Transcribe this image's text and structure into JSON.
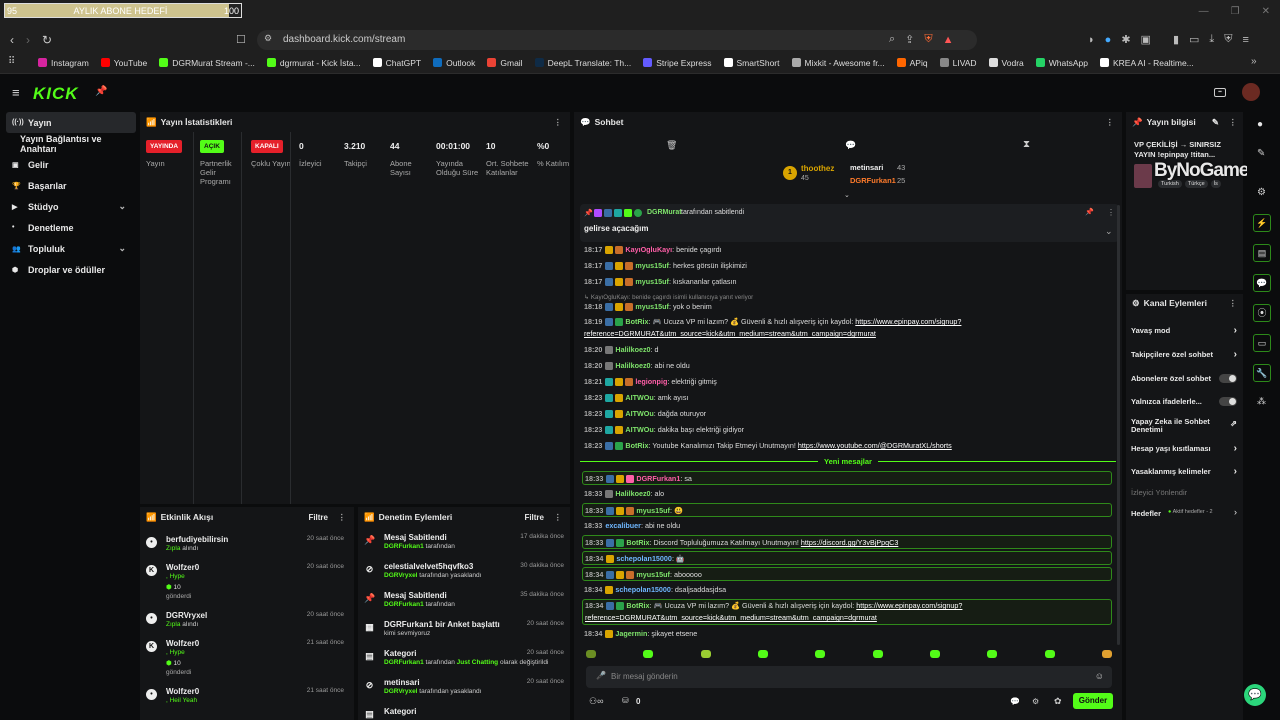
{
  "goal": {
    "left": "95",
    "label": "AYLIK ABONE HEDEFİ",
    "right": "100",
    "progress": 0.95
  },
  "browser": {
    "url": "dashboard.kick.com/stream"
  },
  "bookmarks": [
    {
      "label": "Instagram",
      "color": "#d6249f"
    },
    {
      "label": "YouTube",
      "color": "#ff0000"
    },
    {
      "label": "DGRMurat Stream -...",
      "color": "#53fc18"
    },
    {
      "label": "dgrmurat - Kick İsta...",
      "color": "#53fc18"
    },
    {
      "label": "ChatGPT",
      "color": "#ffffff"
    },
    {
      "label": "Outlook",
      "color": "#0f6cbd"
    },
    {
      "label": "Gmail",
      "color": "#ea4335"
    },
    {
      "label": "DeepL Translate: Th...",
      "color": "#0f2b46"
    },
    {
      "label": "Stripe Express",
      "color": "#635bff"
    },
    {
      "label": "SmartShort",
      "color": "#ffffff"
    },
    {
      "label": "Mixkit - Awesome fr...",
      "color": "#aaaaaa"
    },
    {
      "label": "APiq",
      "color": "#ff6600"
    },
    {
      "label": "LIVAD",
      "color": "#888888"
    },
    {
      "label": "Vodra",
      "color": "#dddddd"
    },
    {
      "label": "WhatsApp",
      "color": "#25d366"
    },
    {
      "label": "KREA AI - Realtime...",
      "color": "#ffffff"
    }
  ],
  "nav": [
    {
      "label": "Yayın",
      "selected": true
    },
    {
      "label": "Yayın Bağlantısı ve Anahtarı"
    },
    {
      "label": "Gelir"
    },
    {
      "label": "Başarılar"
    },
    {
      "label": "Stüdyo",
      "chev": true
    },
    {
      "label": "Denetleme"
    },
    {
      "label": "Topluluk",
      "chev": true
    },
    {
      "label": "Droplar ve ödüller"
    }
  ],
  "stats": {
    "title": "Yayın İstatistikleri",
    "badges": [
      {
        "badge": "YAYINDA",
        "color": "#e5202a",
        "label": "Yayın"
      },
      {
        "badge": "AÇIK",
        "color": "#53fc18",
        "label": "Partnerlik Gelir Programı"
      },
      {
        "badge": "KAPALI",
        "color": "#e5202a",
        "label": "Çoklu Yayın"
      }
    ],
    "values": [
      {
        "value": "0",
        "label": "İzleyici"
      },
      {
        "value": "3.210",
        "label": "Takipçi"
      },
      {
        "value": "44",
        "label": "Abone Sayısı"
      },
      {
        "value": "00:01:00",
        "label": "Yayında Olduğu Süre"
      },
      {
        "value": "10",
        "label": "Ort. Sohbete Katılanlar"
      },
      {
        "value": "%0",
        "label": "% Katılım"
      }
    ]
  },
  "activity": {
    "title": "Etkinlik Akışı",
    "filter": "Filtre",
    "items": [
      {
        "name": "berfudiyebilirsin",
        "sub": "Zıpla",
        "sub_rest": " alındı",
        "time": "20 saat önce"
      },
      {
        "name": "Wolfzer0",
        "sub": ", Hype",
        "count": "10",
        "sub2": "gönderdi",
        "time": "20 saat önce"
      },
      {
        "name": "DGRVryxel",
        "sub": "Zıpla",
        "sub_rest": " alındı",
        "time": "20 saat önce"
      },
      {
        "name": "Wolfzer0",
        "sub": ", Hype",
        "count": "10",
        "sub2": "gönderdi",
        "time": "21 saat önce"
      },
      {
        "name": "Wolfzer0",
        "sub": ", Heil Yeah",
        "time": "21 saat önce"
      }
    ]
  },
  "moderation": {
    "title": "Denetim Eylemleri",
    "filter": "Filtre",
    "items": [
      {
        "title": "Mesaj Sabitlendi",
        "by": "DGRFurkan1",
        "rest": " tarafından",
        "time": "17 dakika önce"
      },
      {
        "title": "celestialvelvet5hqvfko3",
        "by": "DGRVryxel",
        "rest": " tarafından yasaklandı",
        "time": "30 dakika önce"
      },
      {
        "title": "Mesaj Sabitlendi",
        "by": "DGRFurkan1",
        "rest": " tarafından",
        "time": "35 dakika önce"
      },
      {
        "title": "DGRFurkan1 bir Anket başlattı",
        "by": "",
        "rest": "kimi sevmiyoruz",
        "time": "20 saat önce"
      },
      {
        "title": "Kategori",
        "by": "DGRFurkan1",
        "rest": " tarafından Just Chatting olarak değiştirildi",
        "time": "20 saat önce"
      },
      {
        "title": "metinsari",
        "by": "DGRVryxel",
        "rest": " tarafından yasaklandı",
        "time": "20 saat önce"
      },
      {
        "title": "Kategori",
        "by": "",
        "rest": "",
        "time": ""
      }
    ]
  },
  "chat": {
    "title": "Sohbet",
    "top": [
      {
        "name": "thoothez",
        "count": "45",
        "rank": "1"
      },
      {
        "name": "metinsari",
        "count": "43"
      },
      {
        "name": "DGRFurkan1",
        "count": "25"
      }
    ],
    "pinned": {
      "user": "DGRMurat",
      "rest": " tarafından sabitlendi",
      "text": "gelirse açacağım"
    },
    "messages": [
      {
        "t": "18:17",
        "u": "KayıOgluKayı",
        "uc": "#ff5fa8",
        "m": ": benide çagırdı"
      },
      {
        "t": "18:17",
        "u": "myus15uf",
        "uc": "#7ee36b",
        "m": ": herkes görsün ilişkimizi"
      },
      {
        "t": "18:17",
        "u": "myus15uf",
        "uc": "#7ee36b",
        "m": ": kıskananlar çatlasın"
      },
      {
        "t": "",
        "reply": "↳ KayıOgluKayı: benide çagırdı isimli kullanıcıya yanıt veriyor"
      },
      {
        "t": "18:18",
        "u": "myus15uf",
        "uc": "#7ee36b",
        "m": ": yok o benim"
      },
      {
        "t": "18:19",
        "u": "BotRix",
        "uc": "#7ee36b",
        "m": ": 🎮 Ucuza VP mi lazım? 💰 Güvenli & hızlı alışveriş için kaydol: ",
        "l": "https://www.epinpay.com/signup?",
        "m2": "reference=DGRMURAT&utm_source=kick&utm_medium=stream&utm_campaign=dgrmurat"
      },
      {
        "t": "18:20",
        "u": "Halilkoez0",
        "uc": "#7ee36b",
        "m": ": d"
      },
      {
        "t": "18:20",
        "u": "Halilkoez0",
        "uc": "#7ee36b",
        "m": ": abi ne oldu"
      },
      {
        "t": "18:21",
        "u": "legionpig",
        "uc": "#ff5fa8",
        "m": ": elektriği gitmiş"
      },
      {
        "t": "18:23",
        "u": "AITWOu",
        "uc": "#7ee36b",
        "m": ": amk ayısı"
      },
      {
        "t": "18:23",
        "u": "AITWOu",
        "uc": "#7ee36b",
        "m": ": dağda oturuyor"
      },
      {
        "t": "18:23",
        "u": "AITWOu",
        "uc": "#7ee36b",
        "m": ": dakika başı elektriği gidiyor"
      },
      {
        "t": "18:23",
        "u": "BotRix",
        "uc": "#7ee36b",
        "m": ": Youtube Kanalımızı Takip Etmeyi Unutmayın! ",
        "l": "https://www.youtube.com/@DGRMuratXL/shorts"
      }
    ],
    "new_label": "Yeni mesajlar",
    "new_messages": [
      {
        "t": "18:33",
        "u": "DGRFurkan1",
        "uc": "#ff5fa8",
        "m": ": sa"
      },
      {
        "t": "18:33",
        "u": "Halilkoez0",
        "uc": "#7ee36b",
        "m": ": alo"
      },
      {
        "t": "18:33",
        "u": "myus15uf",
        "uc": "#7ee36b",
        "m": ": 😃"
      },
      {
        "t": "18:33",
        "u": "excalibuer",
        "uc": "#6fb7ff",
        "m": ": abi ne oldu"
      },
      {
        "t": "18:33",
        "u": "BotRix",
        "uc": "#7ee36b",
        "m": ": Discord Topluluğumuza Katılmayı Unutmayın! ",
        "l": "https://discord.gg/Y3vBjPpqC3"
      },
      {
        "t": "18:34",
        "u": "schepolan15000",
        "uc": "#6fb7ff",
        "m": ": 🤖"
      },
      {
        "t": "18:34",
        "u": "myus15uf",
        "uc": "#7ee36b",
        "m": ": abooooo"
      },
      {
        "t": "18:34",
        "u": "schepolan15000",
        "uc": "#6fb7ff",
        "m": ": dsaljsaddasjdsa"
      },
      {
        "t": "18:34",
        "u": "BotRix",
        "uc": "#7ee36b",
        "m": ": 🎮 Ucuza VP mi lazım? 💰 Güvenli & hızlı alışveriş için kaydol: ",
        "l": "https://www.epinpay.com/signup?",
        "m2": "reference=DGRMURAT&utm_source=kick&utm_medium=stream&utm_campaign=dgrmurat"
      },
      {
        "t": "18:34",
        "u": "Jagermin",
        "uc": "#7ee36b",
        "m": ": şikayet etsene"
      }
    ],
    "input_placeholder": "Bir mesaj gönderin",
    "points": "0",
    "send": "Gönder"
  },
  "stream_info": {
    "title": "Yayın bilgisi",
    "stream_title": "VP ÇEKİLİŞİ → SINIRSIZ YAYIN !epinpay !titan...",
    "tags": [
      "Turkish",
      "Türkçe",
      "İs"
    ],
    "watermark": "ByNoGame"
  },
  "channel": {
    "title": "Kanal Eylemleri",
    "items": [
      {
        "label": "Yavaş mod",
        "type": "chev"
      },
      {
        "label": "Takipçilere özel sohbet",
        "type": "chev"
      },
      {
        "label": "Abonelere özel sohbet",
        "type": "toggle"
      },
      {
        "label": "Yalnızca ifadelerle...",
        "type": "toggle"
      },
      {
        "label": "Yapay Zeka ile Sohbet Denetimi",
        "type": "ext"
      },
      {
        "label": "Hesap yaşı kısıtlaması",
        "type": "chev"
      },
      {
        "label": "Yasaklanmış kelimeler",
        "type": "chev"
      }
    ],
    "viewer_dir": "İzleyici Yönlendir",
    "hedefler": "Hedefler",
    "hedefler_status": "Aktif hedefler - 2"
  }
}
